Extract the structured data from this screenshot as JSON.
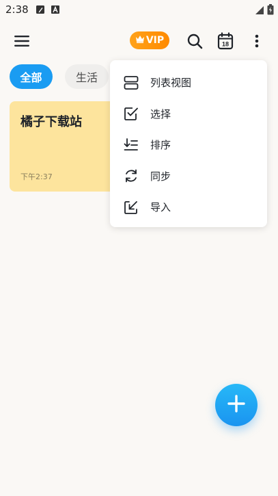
{
  "status_bar": {
    "time": "2:38",
    "icons": [
      "edit-note-icon",
      "a-text-icon",
      "signal-icon",
      "battery-icon"
    ]
  },
  "toolbar": {
    "menu_icon": "hamburger-icon",
    "vip_label": "VIP",
    "vip_icon": "crown-icon",
    "search_icon": "search-icon",
    "calendar_day": "18",
    "more_icon": "more-vertical-icon"
  },
  "categories": [
    {
      "label": "全部",
      "selected": true
    },
    {
      "label": "生活",
      "selected": false
    }
  ],
  "notes": [
    {
      "title": "橘子下载站",
      "time": "下午2:37",
      "color": "#fde49d"
    }
  ],
  "menu": {
    "items": [
      {
        "label": "列表视图",
        "icon": "list-view-icon"
      },
      {
        "label": "选择",
        "icon": "checkbox-icon"
      },
      {
        "label": "排序",
        "icon": "sort-icon"
      },
      {
        "label": "同步",
        "icon": "sync-icon"
      },
      {
        "label": "导入",
        "icon": "import-icon"
      }
    ]
  },
  "fab": {
    "icon": "plus-icon"
  },
  "colors": {
    "accent": "#1a9cf2",
    "vip": "#ff9a0d",
    "note_yellow": "#fde49d",
    "background": "#faf8f5"
  }
}
